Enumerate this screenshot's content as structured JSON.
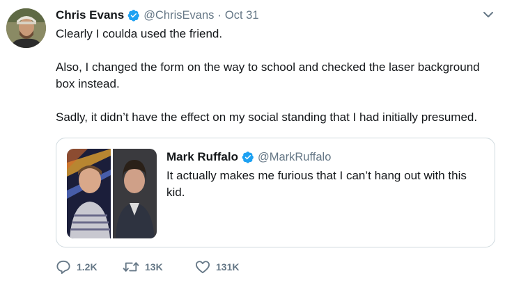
{
  "tweet": {
    "author_name": "Chris Evans",
    "handle": "@ChrisEvans",
    "separator": "·",
    "date": "Oct 31",
    "lines": [
      "Clearly I coulda used the friend.",
      "Also, I changed the form on the way to school and checked the laser background",
      "box instead.",
      "Sadly, it didn’t have the effect on my social standing that I had initially presumed."
    ]
  },
  "quoted": {
    "author_name": "Mark Ruffalo",
    "handle": "@MarkRuffalo",
    "text": "It actually makes me furious that I can’t hang out with this kid."
  },
  "actions": {
    "replies": "1.2K",
    "retweets": "13K",
    "likes": "131K"
  },
  "icons": {
    "verified": "verified-badge-icon",
    "menu": "chevron-down-icon",
    "reply": "reply-icon",
    "retweet": "retweet-icon",
    "like": "heart-icon"
  },
  "colors": {
    "text": "#14171a",
    "secondary": "#657786",
    "verified": "#1da1f2",
    "border": "#cfd9de"
  }
}
